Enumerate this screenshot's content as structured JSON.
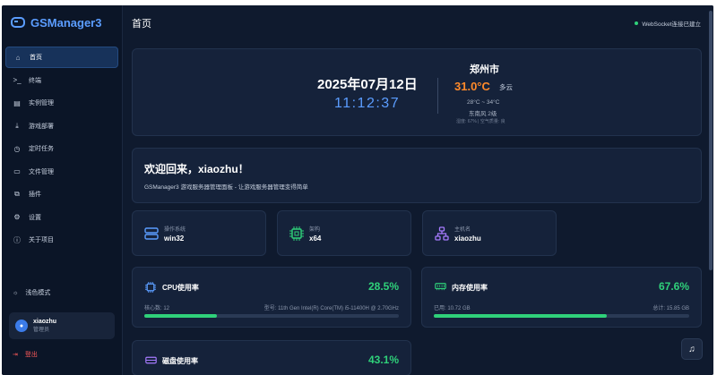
{
  "app": {
    "title": "GSManager3"
  },
  "sidebar": {
    "items": [
      {
        "label": "首页",
        "icon": "home-icon",
        "glyph": "⌂"
      },
      {
        "label": "终端",
        "icon": "terminal-icon",
        "glyph": ">_"
      },
      {
        "label": "实例管理",
        "icon": "server-icon",
        "glyph": "▤"
      },
      {
        "label": "游戏部署",
        "icon": "download-icon",
        "glyph": "⤓"
      },
      {
        "label": "定时任务",
        "icon": "clock-icon",
        "glyph": "◷"
      },
      {
        "label": "文件管理",
        "icon": "folder-icon",
        "glyph": "▭"
      },
      {
        "label": "插件",
        "icon": "plugin-icon",
        "glyph": "⧉"
      },
      {
        "label": "设置",
        "icon": "gear-icon",
        "glyph": "⚙"
      },
      {
        "label": "关于项目",
        "icon": "info-icon",
        "glyph": "ⓘ"
      }
    ],
    "theme_toggle": "浅色模式",
    "user": {
      "name": "xiaozhu",
      "role": "管理员"
    },
    "logout": "登出"
  },
  "header": {
    "title": "首页",
    "ws_status": "WebSocket连接已建立"
  },
  "clock": {
    "date": "2025年07月12日",
    "time": "11:12:37",
    "city": "郑州市",
    "temp": "31.0°C",
    "weather": "多云",
    "range": "28°C ~ 34°C",
    "wind": "东南风 2级",
    "humidity": "湿度: 67% | 空气质量: 良"
  },
  "welcome": {
    "title": "欢迎回来，xiaozhu！",
    "subtitle": "GSManager3 游戏服务器管理面板 - 让游戏服务器管理变得简单"
  },
  "system_info": [
    {
      "label": "操作系统",
      "value": "win32"
    },
    {
      "label": "架构",
      "value": "x64"
    },
    {
      "label": "主机名",
      "value": "xiaozhu"
    }
  ],
  "cpu": {
    "title": "CPU使用率",
    "percent": "28.5%",
    "fraction": 0.285,
    "cores": "核心数: 12",
    "model": "型号: 11th Gen Intel(R) Core(TM) i5-11400H @ 2.70GHz"
  },
  "memory": {
    "title": "内存使用率",
    "percent": "67.6%",
    "fraction": 0.676,
    "used": "已用: 10.72 GB",
    "total": "总计: 15.85 GB"
  },
  "disk": {
    "title": "磁盘使用率",
    "percent": "43.1%"
  },
  "colors": {
    "accent": "#5b9dff",
    "success": "#2fd17a",
    "temp": "#ff8a2a",
    "danger": "#ff5a5a"
  }
}
